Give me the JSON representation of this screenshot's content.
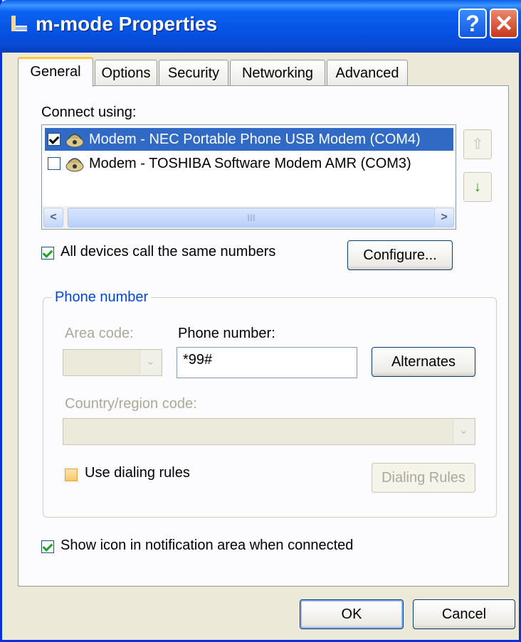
{
  "window": {
    "title": "m-mode Properties",
    "help_glyph": "?",
    "close_glyph": "✕"
  },
  "tabs": [
    {
      "label": "General",
      "active": true
    },
    {
      "label": "Options",
      "active": false
    },
    {
      "label": "Security",
      "active": false
    },
    {
      "label": "Networking",
      "active": false
    },
    {
      "label": "Advanced",
      "active": false
    }
  ],
  "connect_using": {
    "label": "Connect using:",
    "devices": [
      {
        "label": "Modem - NEC Portable Phone USB Modem (COM4)",
        "checked": true,
        "selected": true
      },
      {
        "label": "Modem - TOSHIBA Software Modem AMR (COM3)",
        "checked": false,
        "selected": false
      }
    ],
    "up_glyph": "⇧",
    "down_glyph": "↓",
    "scroll_left": "<",
    "scroll_right": ">",
    "scroll_grip": "III"
  },
  "all_devices": {
    "label": "All devices call the same numbers",
    "checked": true
  },
  "configure_button": "Configure...",
  "phone_group": {
    "title": "Phone number",
    "area_code_label": "Area code:",
    "phone_number_label": "Phone number:",
    "phone_number_value": "*99#",
    "alternates_button": "Alternates",
    "country_label": "Country/region code:",
    "use_dialing_rules": {
      "label": "Use dialing rules",
      "checked": false
    },
    "dialing_rules_button": "Dialing Rules",
    "combo_arrow": "⌄"
  },
  "show_icon": {
    "label": "Show icon in notification area when connected",
    "checked": true
  },
  "footer": {
    "ok": "OK",
    "cancel": "Cancel"
  },
  "colors": {
    "title_bar": "#0553e3",
    "selection": "#316ac5",
    "group_title": "#0046d5",
    "tab_highlight": "#ffc83c"
  }
}
